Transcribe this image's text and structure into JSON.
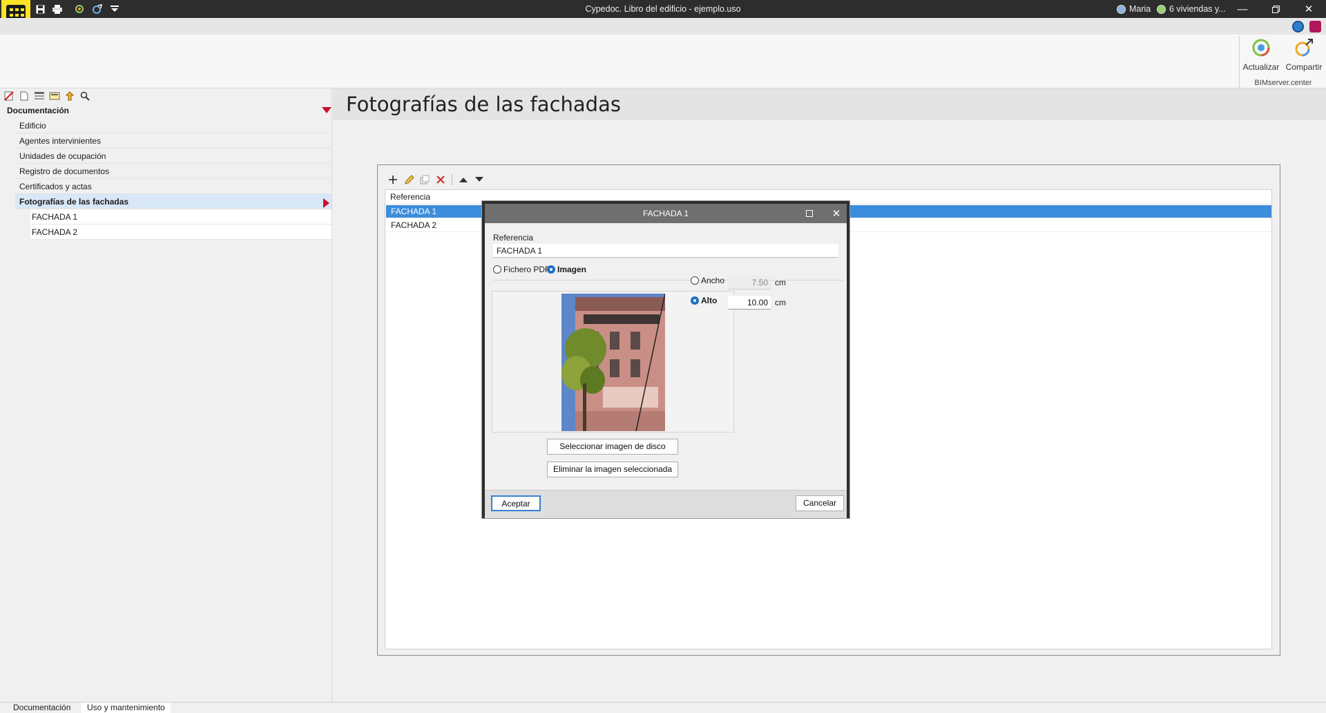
{
  "titlebar": {
    "title": "Cypedoc. Libro del edificio - ejemplo.uso",
    "user": "Maria",
    "project": "6 viviendas y..."
  },
  "ribbon": {
    "update_label": "Actualizar",
    "share_label": "Compartir",
    "group_label": "BIMserver.center"
  },
  "tree": {
    "root": "Documentación",
    "items": [
      {
        "label": "Edificio"
      },
      {
        "label": "Agentes intervinientes"
      },
      {
        "label": "Unidades de ocupación"
      },
      {
        "label": "Registro de documentos"
      },
      {
        "label": "Certificados y actas"
      },
      {
        "label": "Fotografías de las fachadas"
      }
    ],
    "subitems": [
      {
        "label": "FACHADA 1"
      },
      {
        "label": "FACHADA 2"
      }
    ]
  },
  "main": {
    "title": "Fotografías de las fachadas",
    "list_header": "Referencia",
    "rows": [
      {
        "label": "FACHADA 1"
      },
      {
        "label": "FACHADA 2"
      }
    ]
  },
  "dialog": {
    "title": "FACHADA 1",
    "ref_label": "Referencia",
    "ref_value": "FACHADA 1",
    "option_pdf": "Fichero PDF",
    "option_image": "Imagen",
    "width_label": "Ancho",
    "width_value": "7.50",
    "height_label": "Alto",
    "height_value": "10.00",
    "unit": "cm",
    "select_image_btn": "Seleccionar imagen de disco",
    "delete_image_btn": "Eliminar la imagen seleccionada",
    "accept_btn": "Aceptar",
    "cancel_btn": "Cancelar"
  },
  "bottom_tabs": [
    {
      "label": "Documentación"
    },
    {
      "label": "Uso y mantenimiento"
    }
  ]
}
